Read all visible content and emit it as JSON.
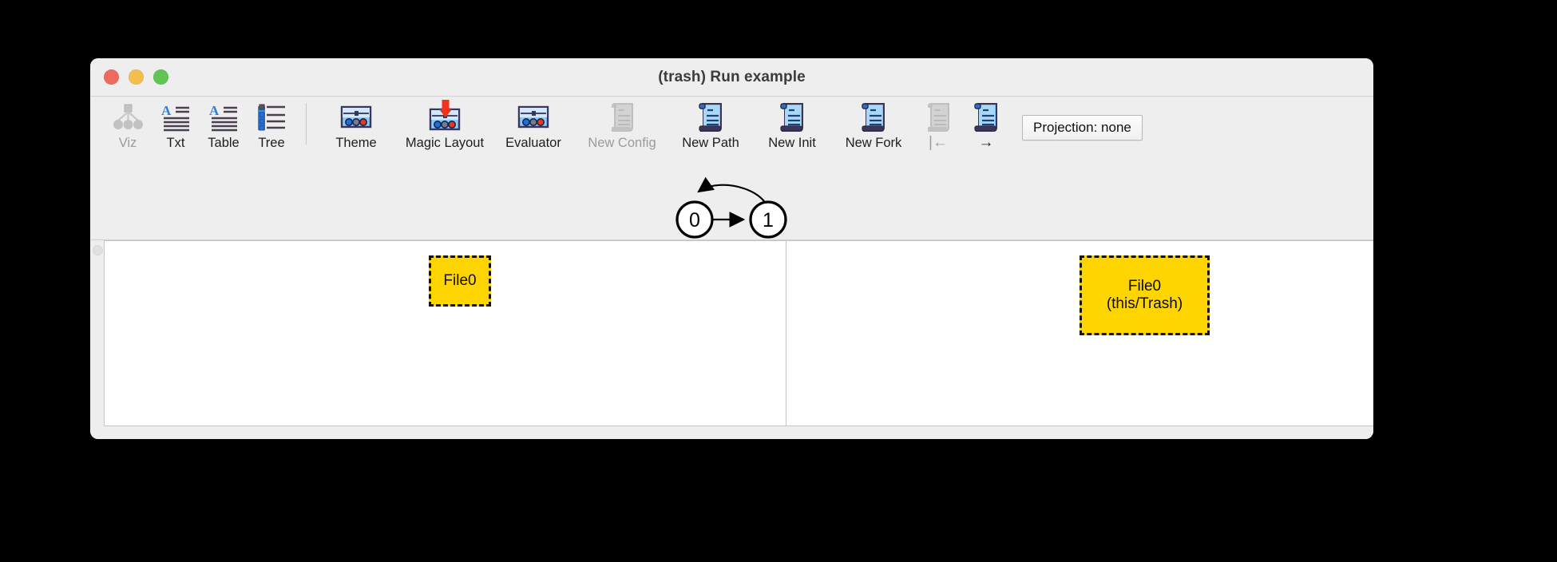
{
  "window": {
    "title": "(trash) Run example",
    "traffic_lights": [
      {
        "name": "close",
        "color": "#ed6a5e"
      },
      {
        "name": "minimize",
        "color": "#f4bd4f"
      },
      {
        "name": "maximize",
        "color": "#61c455"
      }
    ]
  },
  "toolbar": {
    "items": [
      {
        "label": "Viz",
        "icon": "viz-tree-icon",
        "enabled": false
      },
      {
        "label": "Txt",
        "icon": "text-document-icon",
        "enabled": true
      },
      {
        "label": "Table",
        "icon": "table-document-icon",
        "enabled": true
      },
      {
        "label": "Tree",
        "icon": "tree-list-icon",
        "enabled": true
      },
      {
        "label": "Theme",
        "icon": "theme-panel-icon",
        "enabled": true
      },
      {
        "label": "Magic Layout",
        "icon": "magic-layout-icon",
        "enabled": true
      },
      {
        "label": "Evaluator",
        "icon": "evaluator-panel-icon",
        "enabled": true
      },
      {
        "label": "New Config",
        "icon": "scroll-gray-icon",
        "enabled": false
      },
      {
        "label": "New Path",
        "icon": "scroll-blue-icon",
        "enabled": true
      },
      {
        "label": "New Init",
        "icon": "scroll-blue-icon",
        "enabled": true
      },
      {
        "label": "New Fork",
        "icon": "scroll-blue-icon",
        "enabled": true
      },
      {
        "label": "|←",
        "icon": "scroll-gray-icon",
        "enabled": false
      },
      {
        "label": "→",
        "icon": "scroll-blue-icon",
        "enabled": true
      }
    ],
    "projection_label": "Projection: none"
  },
  "graph": {
    "nodes": [
      {
        "id": "0",
        "label": "0"
      },
      {
        "id": "1",
        "label": "1"
      }
    ],
    "edges": [
      {
        "from": "0",
        "to": "1",
        "style": "straight"
      },
      {
        "from": "1",
        "to": "0",
        "style": "curved"
      }
    ]
  },
  "panes": {
    "left": {
      "atoms": [
        {
          "lines": [
            "File0"
          ],
          "fill": "#ffd500",
          "border": "#141414"
        }
      ]
    },
    "right": {
      "atoms": [
        {
          "lines": [
            "File0",
            "(this/Trash)"
          ],
          "fill": "#ffd500",
          "border": "#141414"
        }
      ]
    }
  }
}
